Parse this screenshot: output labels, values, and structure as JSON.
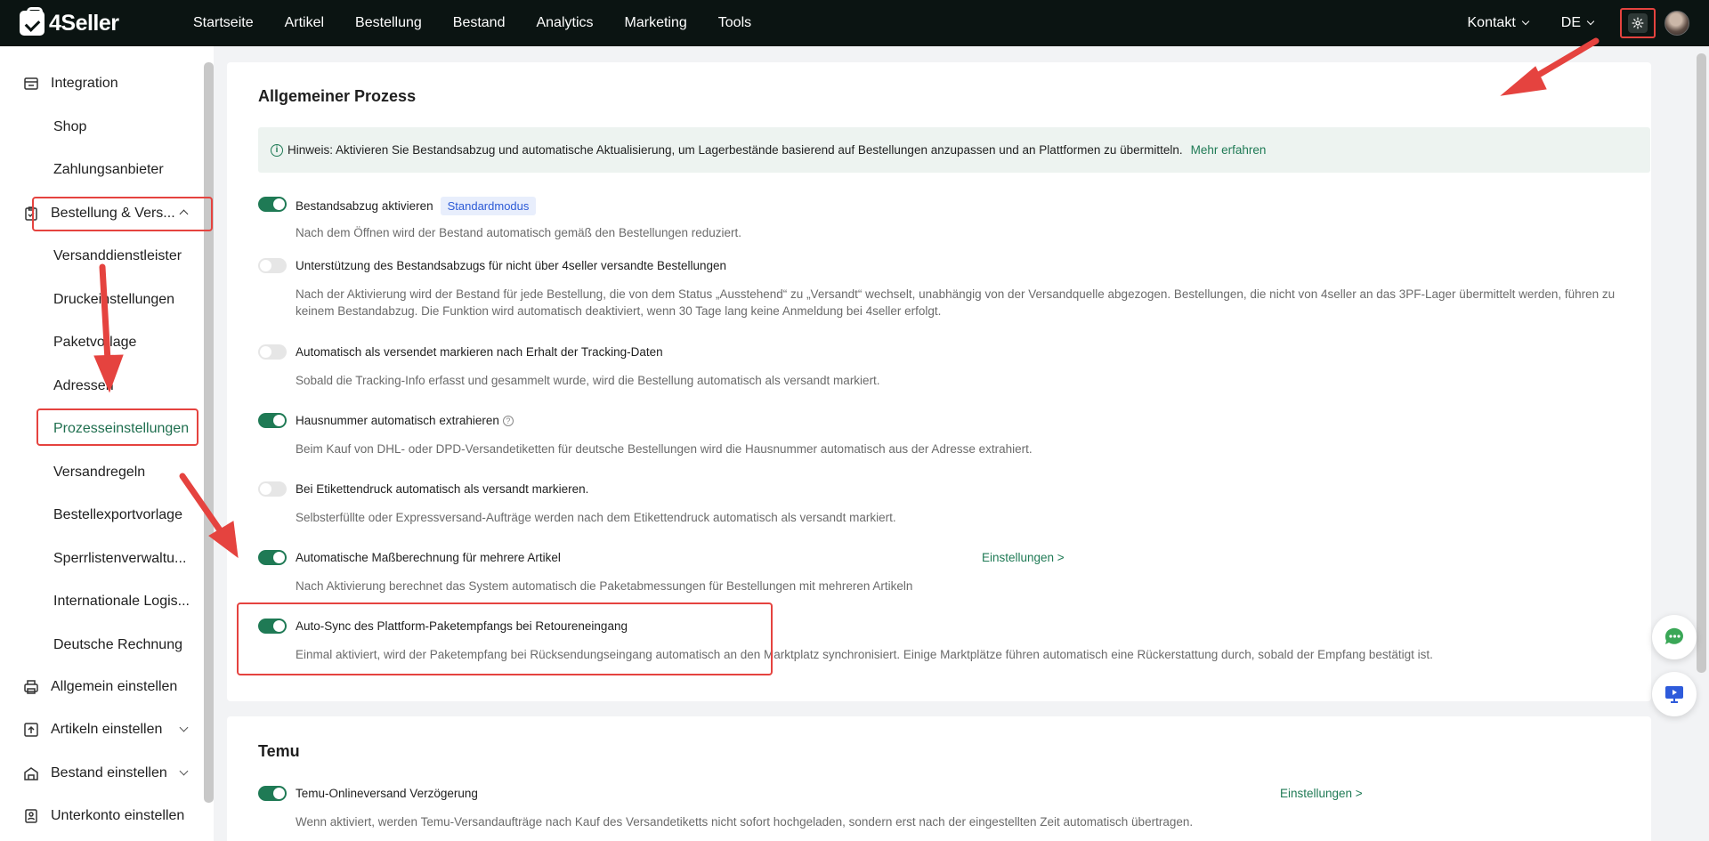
{
  "brand": {
    "name": "4Seller"
  },
  "topnav": {
    "items": [
      "Startseite",
      "Artikel",
      "Bestellung",
      "Bestand",
      "Analytics",
      "Marketing",
      "Tools"
    ],
    "contact": "Kontakt",
    "language": "DE"
  },
  "sidebar": {
    "items": [
      {
        "label": "Integration",
        "icon": "integration-icon"
      },
      {
        "label": "Shop"
      },
      {
        "label": "Zahlungsanbieter"
      },
      {
        "label": "Bestellung & Vers...",
        "icon": "order-icon",
        "expanded": true
      },
      {
        "label": "Versanddienstleister"
      },
      {
        "label": "Druckeinstellungen"
      },
      {
        "label": "Paketvorlage"
      },
      {
        "label": "Adressen"
      },
      {
        "label": "Prozesseinstellungen",
        "active": true
      },
      {
        "label": "Versandregeln"
      },
      {
        "label": "Bestellexportvorlage"
      },
      {
        "label": "Sperrlistenverwaltu..."
      },
      {
        "label": "Internationale Logis..."
      },
      {
        "label": "Deutsche Rechnung"
      },
      {
        "label": "Allgemein einstellen",
        "icon": "general-settings-icon"
      },
      {
        "label": "Artikeln einstellen",
        "icon": "product-settings-icon"
      },
      {
        "label": "Bestand einstellen",
        "icon": "inventory-settings-icon"
      },
      {
        "label": "Unterkonto einstellen",
        "icon": "subaccount-icon"
      }
    ]
  },
  "general": {
    "title": "Allgemeiner Prozess",
    "notice": "Hinweis: Aktivieren Sie Bestandsabzug und automatische Aktualisierung, um Lagerbestände basierend auf Bestellungen anzupassen und an Plattformen zu übermitteln.",
    "notice_link": "Mehr erfahren",
    "settings": [
      {
        "label": "Bestandsabzug aktivieren",
        "badge": "Standardmodus",
        "enabled": true,
        "desc": "Nach dem Öffnen wird der Bestand automatisch gemäß den Bestellungen reduziert."
      },
      {
        "label": "Unterstützung des Bestandsabzugs für nicht über 4seller versandte Bestellungen",
        "enabled": false,
        "desc": "Nach der Aktivierung wird der Bestand für jede Bestellung, die von dem Status „Ausstehend“ zu „Versandt“ wechselt, unabhängig von der Versandquelle abgezogen. Bestellungen, die nicht von 4seller an das 3PF-Lager übermittelt werden, führen zu keinem Bestandabzug. Die Funktion wird automatisch deaktiviert, wenn 30 Tage lang keine Anmeldung bei 4seller erfolgt."
      },
      {
        "label": "Automatisch als versendet markieren nach Erhalt der Tracking-Daten",
        "enabled": false,
        "desc": "Sobald die Tracking-Info erfasst und gesammelt wurde, wird die Bestellung automatisch als versandt markiert."
      },
      {
        "label": "Hausnummer automatisch extrahieren",
        "enabled": true,
        "desc": "Beim Kauf von DHL- oder DPD-Versandetiketten für deutsche Bestellungen wird die Hausnummer automatisch aus der Adresse extrahiert."
      },
      {
        "label": "Bei Etikettendruck automatisch als versandt markieren.",
        "enabled": false,
        "desc": "Selbsterfüllte oder Expressversand-Aufträge werden nach dem Etikettendruck automatisch als versandt markiert."
      },
      {
        "label": "Automatische Maßberechnung für mehrere Artikel",
        "enabled": true,
        "link": "Einstellungen >",
        "desc": "Nach Aktivierung berechnet das System automatisch die Paketabmessungen für Bestellungen mit mehreren Artikeln"
      },
      {
        "label": "Auto-Sync des Plattform-Paketempfangs bei Retoureneingang",
        "enabled": true,
        "desc": "Einmal aktiviert, wird der Paketempfang bei Rücksendungseingang automatisch an den Marktplatz synchronisiert. Einige Marktplätze führen automatisch eine Rückerstattung durch, sobald der Empfang bestätigt ist."
      }
    ]
  },
  "temu": {
    "title": "Temu",
    "settings": [
      {
        "label": "Temu-Onlineversand Verzögerung",
        "enabled": true,
        "link": "Einstellungen >",
        "desc": "Wenn aktiviert, werden Temu-Versandaufträge nach Kauf des Versandetiketts nicht sofort hochgeladen, sondern erst nach der eingestellten Zeit automatisch übertragen."
      }
    ]
  },
  "colors": {
    "accent": "#1f7a55",
    "annotation": "#e5433f",
    "topbar": "#0b1412"
  }
}
